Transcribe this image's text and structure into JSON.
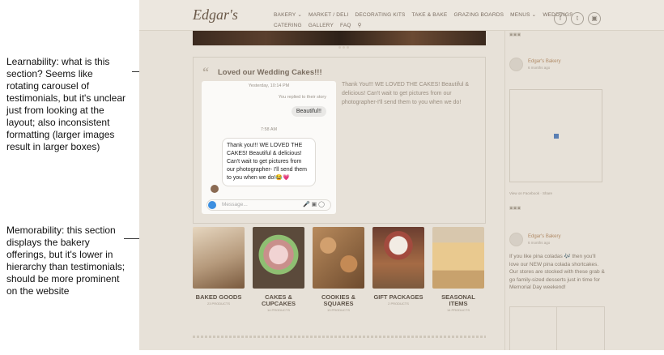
{
  "annotations": {
    "learnability": "Learnability: what is this section? Seems like rotating carousel of testimonials, but it's unclear just from looking at the layout; also inconsistent formatting (larger images result in larger boxes)",
    "memorability": "Memorability: this section displays the bakery offerings, but it's lower in hierarchy than testimonials; should be more prominent on the website"
  },
  "site": {
    "logo": "Edgar's",
    "nav_row1": [
      "BAKERY ⌄",
      "MARKET / DELI",
      "DECORATING KITS",
      "TAKE & BAKE",
      "GRAZING BOARDS",
      "MENUS ⌄",
      "WEDDINGS"
    ],
    "nav_row2": [
      "CATERING",
      "GALLERY",
      "FAQ"
    ],
    "social_icons": [
      "facebook-icon",
      "twitter-icon",
      "instagram-icon"
    ],
    "testimonial": {
      "title": "Loved our Wedding Cakes!!!",
      "chat_timestamp1": "Yesterday, 10:14 PM",
      "chat_replied": "You replied to their story",
      "chat_bubble1": "Beautiful!!",
      "chat_timestamp2": "7:58 AM",
      "chat_bubble2": "Thank you!!! WE LOVED THE CAKES! Beautiful & delicious! Can't wait to get pictures from our photographer- I'll send them to you when we do!😂💗",
      "message_placeholder": "Message...",
      "text": "Thank You!!! WE LOVED THE CAKES! Beautiful & delicious! Can't wait to get pictures from our photographer-I'll send them to you when we do!"
    },
    "products": [
      {
        "name": "BAKED GOODS",
        "count": "23 PRODUCTS",
        "color": "#b69a7c"
      },
      {
        "name": "CAKES & CUPCAKES",
        "count": "14 PRODUCTS",
        "color": "#c98f8b"
      },
      {
        "name": "COOKIES & SQUARES",
        "count": "13 PRODUCTS",
        "color": "#a5784f"
      },
      {
        "name": "GIFT PACKAGES",
        "count": "2 PRODUCTS",
        "color": "#a24a3e"
      },
      {
        "name": "SEASONAL ITEMS",
        "count": "14 PRODUCTS",
        "color": "#e2b877"
      }
    ],
    "sidebar": {
      "author1": "Edgar's Bakery",
      "time1": "6 months ago",
      "view_fb": "View on Facebook · Share",
      "author2": "Edgar's Bakery",
      "time2": "6 months ago",
      "post_text": "If you like pina coladas 🎶 then you'll love our NEW pina colada shortcakes. Our stores are stocked with these grab & go family-sized desserts just in time for Memorial Day weekend!"
    }
  }
}
